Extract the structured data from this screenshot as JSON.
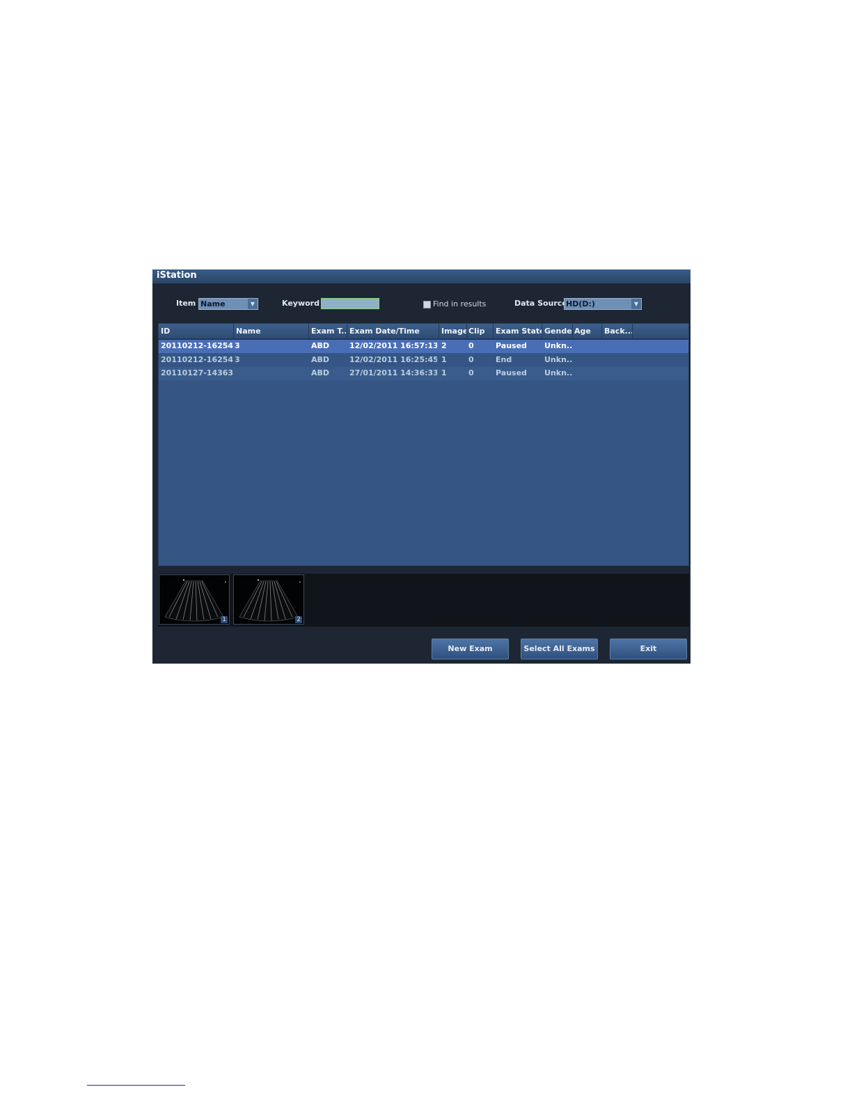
{
  "window": {
    "title": "iStation"
  },
  "search": {
    "item_label": "Item",
    "item_value": "Name",
    "keyword_label": "Keyword",
    "keyword_value": "",
    "find_in_results_label": "Find in results",
    "find_in_results_checked": false,
    "data_source_label": "Data Source",
    "data_source_value": "HD(D:)"
  },
  "table": {
    "columns": [
      "ID",
      "Name",
      "Exam T...",
      "Exam Date/Time",
      "Image",
      "Clip",
      "Exam State",
      "Gender",
      "Age",
      "Back..."
    ],
    "rows": [
      {
        "id": "20110212-16254...",
        "name": "3",
        "exam_type": "ABD",
        "datetime": "12/02/2011 16:57:13",
        "image": "2",
        "clip": "0",
        "state": "Paused",
        "gender": "Unkn...",
        "age": "",
        "back": "",
        "selected": true
      },
      {
        "id": "20110212-16254...",
        "name": "3",
        "exam_type": "ABD",
        "datetime": "12/02/2011 16:25:45",
        "image": "1",
        "clip": "0",
        "state": "End",
        "gender": "Unkn...",
        "age": "",
        "back": "",
        "selected": false
      },
      {
        "id": "20110127-14363...",
        "name": "",
        "exam_type": "ABD",
        "datetime": "27/01/2011 14:36:33",
        "image": "1",
        "clip": "0",
        "state": "Paused",
        "gender": "Unkn...",
        "age": "",
        "back": "",
        "selected": false
      }
    ]
  },
  "thumbnails": [
    {
      "index": "1"
    },
    {
      "index": "2"
    }
  ],
  "buttons": {
    "new_exam": "New Exam",
    "select_all": "Select All Exams",
    "exit": "Exit"
  },
  "colors": {
    "selected_row": "#4a6eb6",
    "table_bg": "#355684",
    "window_bg": "#1d2632",
    "title_bar": "#2a4668"
  }
}
